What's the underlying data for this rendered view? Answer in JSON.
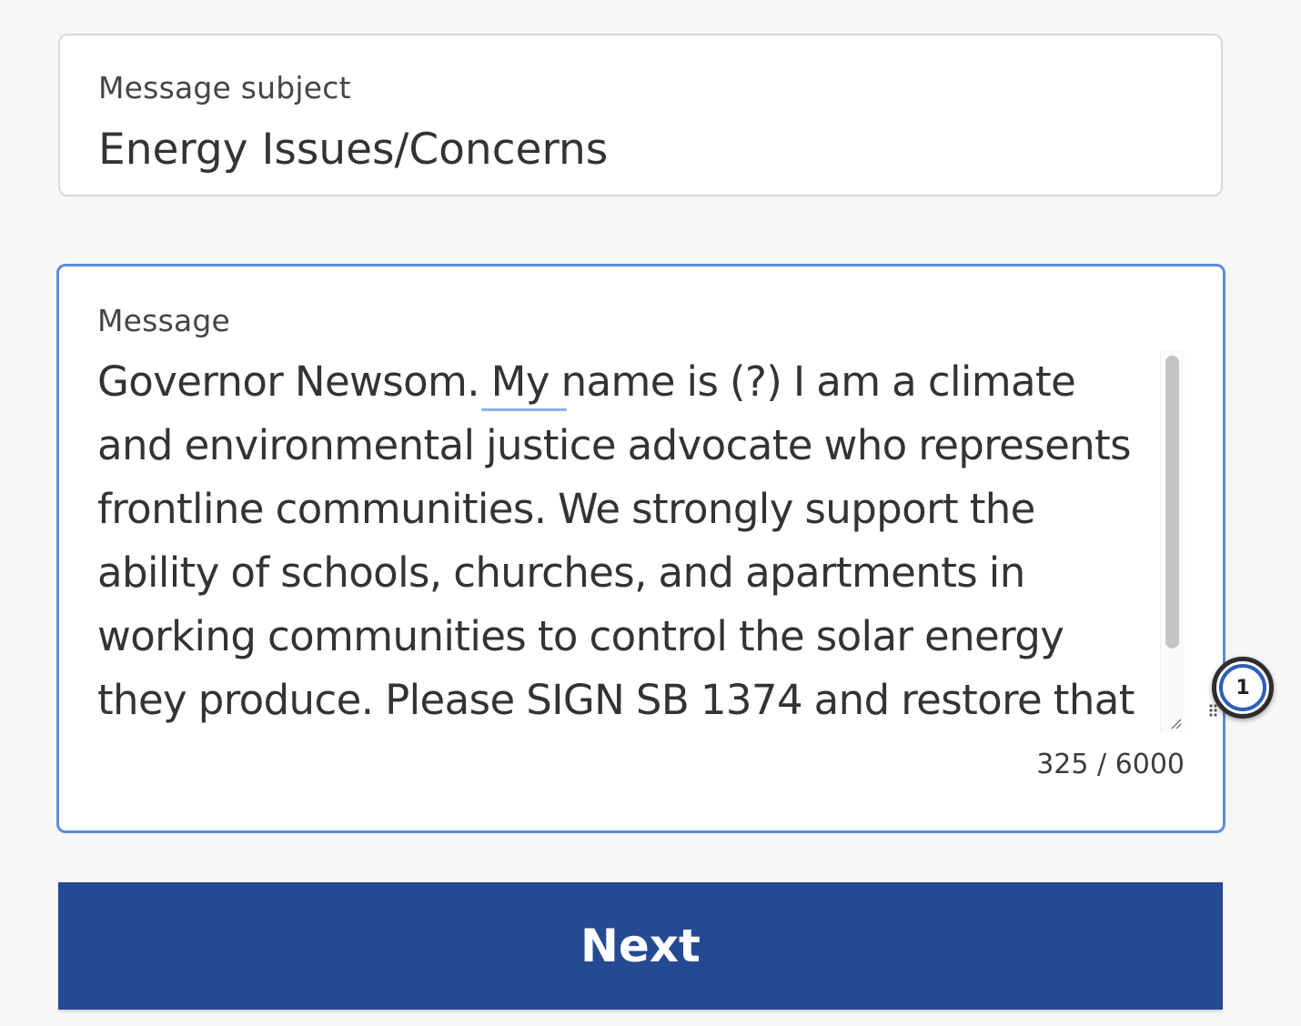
{
  "subject": {
    "label": "Message subject",
    "value": "Energy Issues/Concerns"
  },
  "message": {
    "label": "Message",
    "text": "Governor Newsom. My name is (?) I am a climate and environmental justice advocate who represents frontline communities. We strongly support the ability of schools, churches, and apartments in working communities to control the solar energy they produce. Please SIGN SB 1374 and restore that",
    "char_count": "325 / 6000"
  },
  "badge": {
    "count": "1"
  },
  "next_button": {
    "label": "Next"
  },
  "colors": {
    "accent_border": "#5b8dd9",
    "button_bg": "#264a92"
  }
}
